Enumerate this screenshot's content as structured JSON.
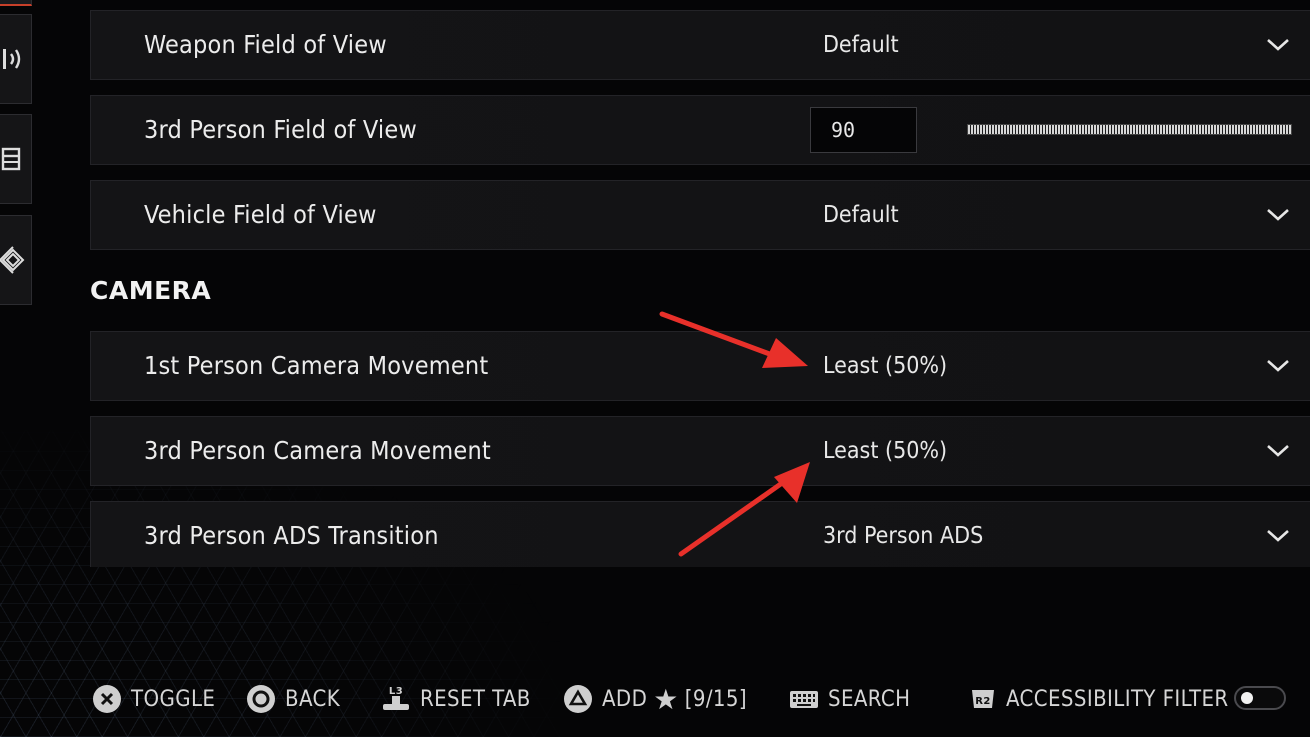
{
  "settings": {
    "rows": [
      {
        "label": "Weapon Field of View",
        "value": "Default"
      },
      {
        "label": "3rd Person Field of View",
        "value": "90"
      },
      {
        "label": "Vehicle Field of View",
        "value": "Default"
      }
    ],
    "camera_title": "CAMERA",
    "camera_rows": [
      {
        "label": "1st Person Camera Movement",
        "value": "Least (50%)"
      },
      {
        "label": "3rd Person Camera Movement",
        "value": "Least (50%)"
      },
      {
        "label": "3rd Person ADS Transition",
        "value": "3rd Person ADS"
      }
    ]
  },
  "footer": {
    "toggle": "TOGGLE",
    "back": "BACK",
    "reset_tab": "RESET TAB",
    "add": "ADD",
    "favorites_count": "[9/15]",
    "search": "SEARCH",
    "accessibility_filter": "ACCESSIBILITY FILTER",
    "l3_label": "L3",
    "r2_label": "R2"
  },
  "colors": {
    "annotation_arrow": "#e8302a",
    "active_tab_edge": "#c8402a"
  }
}
